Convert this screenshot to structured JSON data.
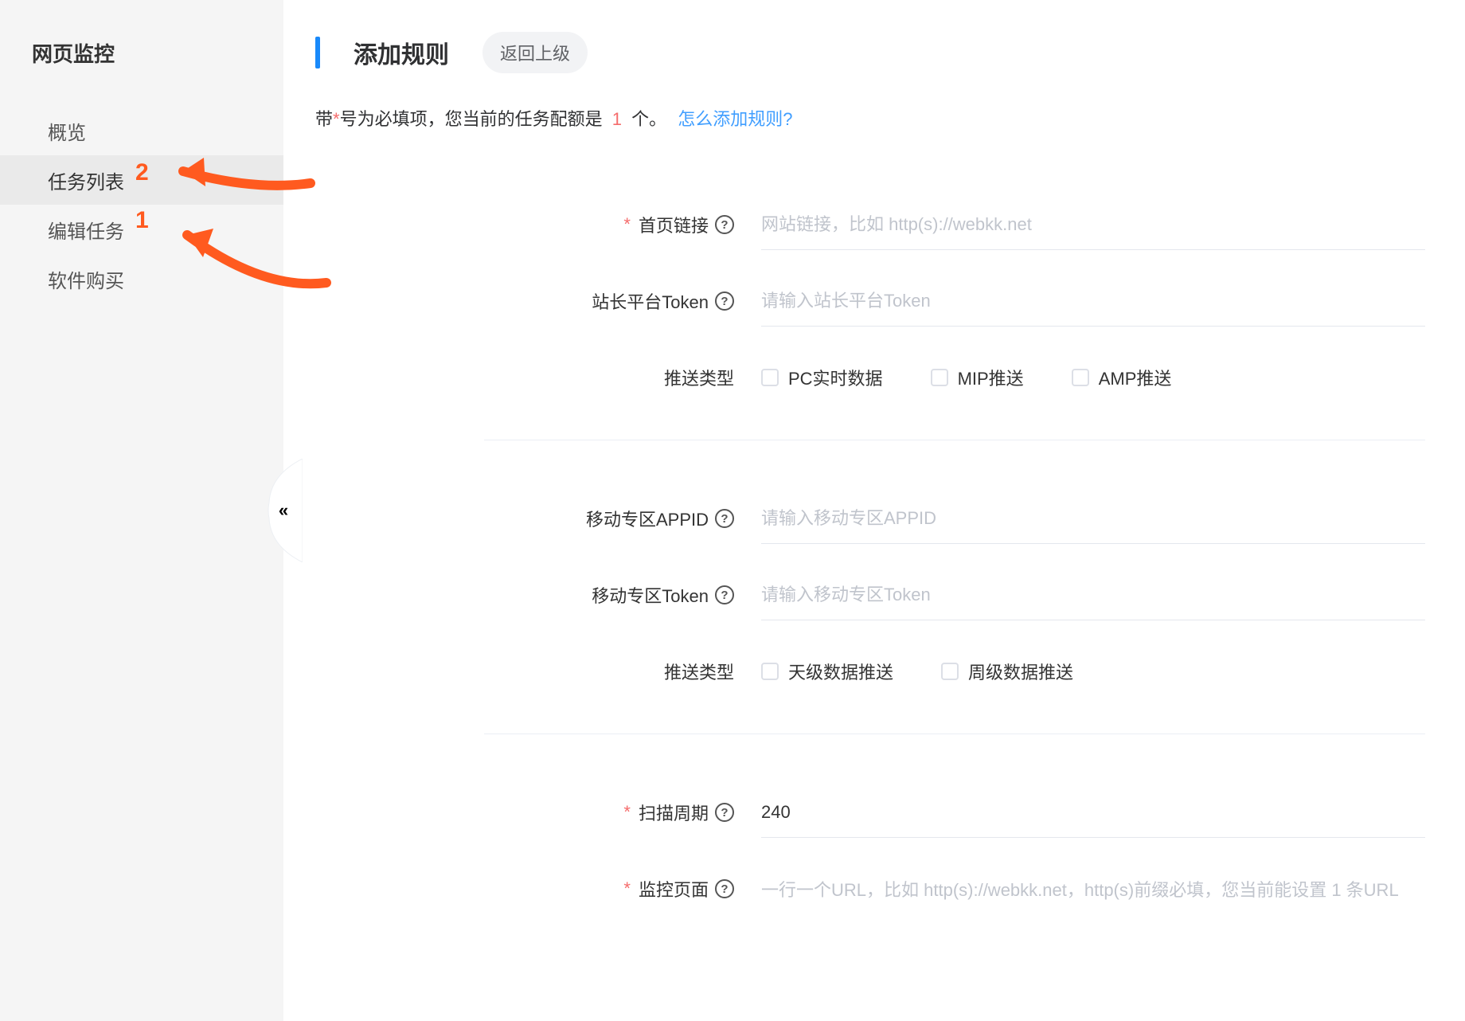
{
  "sidebar": {
    "title": "网页监控",
    "items": [
      {
        "label": "概览"
      },
      {
        "label": "任务列表"
      },
      {
        "label": "编辑任务"
      },
      {
        "label": "软件购买"
      }
    ]
  },
  "annotations": {
    "num1": "1",
    "num2": "2"
  },
  "header": {
    "title": "添加规则",
    "back": "返回上级"
  },
  "notice": {
    "prefix": "带",
    "star": "*",
    "mid": "号为必填项，您当前的任务配额是 ",
    "quota": "1",
    "suffix": " 个。",
    "link": "怎么添加规则?"
  },
  "form": {
    "homepage": {
      "label": "首页链接",
      "placeholder": "网站链接，比如 http(s)://webkk.net"
    },
    "siteToken": {
      "label": "站长平台Token",
      "placeholder": "请输入站长平台Token"
    },
    "pushType1": {
      "label": "推送类型",
      "options": [
        "PC实时数据",
        "MIP推送",
        "AMP推送"
      ]
    },
    "mobileAppid": {
      "label": "移动专区APPID",
      "placeholder": "请输入移动专区APPID"
    },
    "mobileToken": {
      "label": "移动专区Token",
      "placeholder": "请输入移动专区Token"
    },
    "pushType2": {
      "label": "推送类型",
      "options": [
        "天级数据推送",
        "周级数据推送"
      ]
    },
    "scanCycle": {
      "label": "扫描周期",
      "value": "240"
    },
    "monitorPage": {
      "label": "监控页面",
      "placeholder": "一行一个URL，比如 http(s)://webkk.net，http(s)前缀必填，您当前能设置 1 条URL"
    }
  }
}
